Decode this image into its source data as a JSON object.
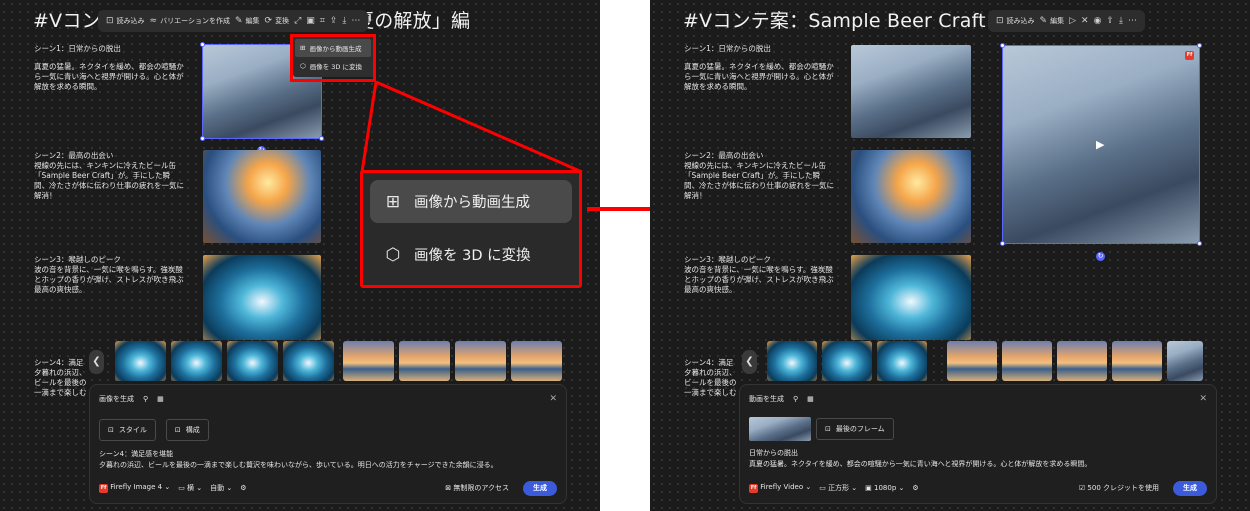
{
  "left": {
    "title": "#Vコンテ案：Sample Beer Craft「夏の解放」編",
    "toolbar": {
      "items": [
        "読み込み",
        "バリエーションを作成",
        "編集",
        "変換"
      ],
      "more": "⋯"
    },
    "context_menu": {
      "items": [
        "画像から動画生成",
        "画像を 3D に変換"
      ]
    },
    "callout": {
      "items": [
        "画像から動画生成",
        "画像を 3D に変換"
      ]
    },
    "scenes": [
      {
        "heading": "シーン1：日常からの脱出",
        "body": "真夏の猛暑。ネクタイを緩め、都会の喧騒から一気に青い海へと視界が開ける。心と体が解放を求める瞬間。"
      },
      {
        "heading": "シーン2：最高の出会い",
        "body": "視線の先には、キンキンに冷えたビール缶「Sample Beer Craft」が。手にした瞬間、冷たさが体に伝わり仕事の疲れを一気に解消！"
      },
      {
        "heading": "シーン3：喉越しのピーク",
        "body": "波の音を背景に、一気に喉を鳴らす。強炭酸とホップの香りが弾け、ストレスが吹き飛ぶ最高の爽快感。"
      },
      {
        "heading": "シーン4：満足",
        "body": "夕暮れの浜辺、ビールを最後の一滴まで楽しむ贅沢。明日への活力をチャージできた余韻に浸る。"
      }
    ],
    "panel": {
      "title": "画像を生成",
      "style_btn": "スタイル",
      "composition_btn": "構成",
      "prompt_line1": "シーン4：満足感を堪能",
      "prompt_line2": "夕暮れの浜辺、ビールを最後の一滴まで楽しむ贅沢を味わいながら、歩いている。明日への活力をチャージできた余韻に浸る。",
      "model": "Firefly Image 4",
      "aspect": "横",
      "mode": "自動",
      "unlimited": "無制限のアクセス",
      "generate": "生成"
    }
  },
  "right": {
    "title": "#Vコンテ案：Sample Beer Craft「夏の解放」編",
    "toolbar": {
      "items": [
        "読み込み",
        "編集"
      ]
    },
    "scenes": [
      {
        "heading": "シーン1：日常からの脱出",
        "body": "真夏の猛暑。ネクタイを緩め、都会の喧騒から一気に青い海へと視界が開ける。心と体が解放を求める瞬間。"
      },
      {
        "heading": "シーン2：最高の出会い",
        "body": "視線の先には、キンキンに冷えたビール缶「Sample Beer Craft」が。手にした瞬間、冷たさが体に伝わり仕事の疲れを一気に解消！"
      },
      {
        "heading": "シーン3：喉越しのピーク",
        "body": "波の音を背景に、一気に喉を鳴らす。強炭酸とホップの香りが弾け、ストレスが吹き飛ぶ最高の爽快感。"
      },
      {
        "heading": "シーン4：満足",
        "body": "夕暮れの浜辺、ビールを最後の一滴まで楽しむ贅沢。明日への活力をチャージできた余韻に浸る。"
      }
    ],
    "panel": {
      "title": "動画を生成",
      "last_frame_btn": "最後のフレーム",
      "prompt_line1": "日常からの脱出",
      "prompt_line2": "真夏の猛暑。ネクタイを緩め、都会の喧騒から一気に青い海へと視界が開ける。心と体が解放を求める瞬間。",
      "model": "Firefly Video",
      "aspect": "正方形",
      "resolution": "1080p",
      "credits": "500 クレジットを使用",
      "generate": "生成"
    }
  },
  "colors": {
    "accent_red": "#ff0000",
    "generate_blue": "#3b5bdb",
    "selection": "#5a66ff",
    "firefly": "#e53b2c"
  }
}
